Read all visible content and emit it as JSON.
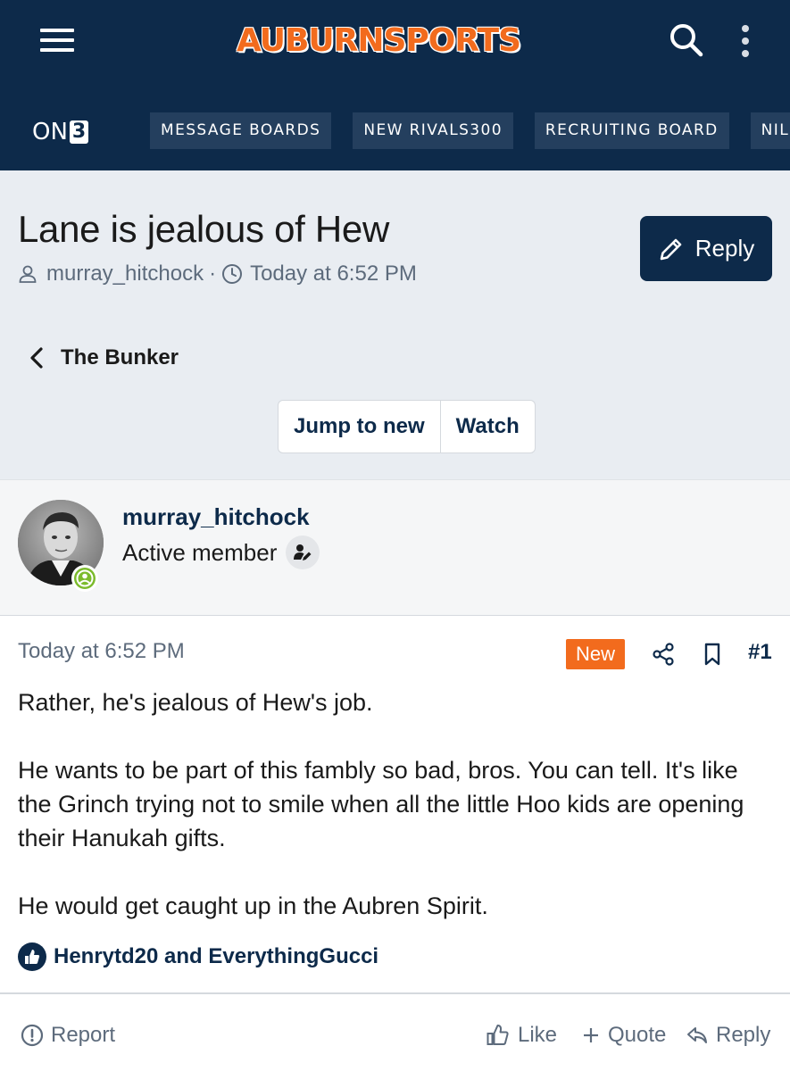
{
  "header": {
    "logo_text": "AUBURNSPORTS",
    "network_logo": "ON",
    "network_logo_suffix": "3",
    "nav": [
      {
        "label": "MESSAGE BOARDS"
      },
      {
        "label": "NEW RIVALS300"
      },
      {
        "label": "RECRUITING BOARD"
      },
      {
        "label": "NIL VA"
      }
    ],
    "icons": [
      "menu-icon",
      "search-icon",
      "more-vertical-icon"
    ]
  },
  "thread": {
    "title": "Lane is jealous of Hew",
    "author": "murray_hitchock",
    "separator": "·",
    "time": "Today at 6:52 PM",
    "reply_label": "Reply",
    "breadcrumb": "The Bunker",
    "jump_label": "Jump to new",
    "watch_label": "Watch"
  },
  "post": {
    "username": "murray_hitchock",
    "role": "Active member",
    "time": "Today at 6:52 PM",
    "new_badge": "New",
    "number": "#1",
    "paragraphs": [
      "Rather, he's jealous of Hew's job.",
      "He wants to be part of this fambly so bad, bros. You can tell. It's like the Grinch trying not to smile when all the little Hoo kids are opening their Hanukah gifts.",
      "He would get caught up in the Aubren Spirit."
    ],
    "likes_text": "Henrytd20 and EverythingGucci",
    "actions": {
      "report": "Report",
      "like": "Like",
      "quote": "Quote",
      "reply": "Reply"
    }
  },
  "colors": {
    "navy": "#0d2a4a",
    "orange": "#f26b1d",
    "online_green": "#7cbb2d",
    "muted_text": "#5d6b7c"
  }
}
